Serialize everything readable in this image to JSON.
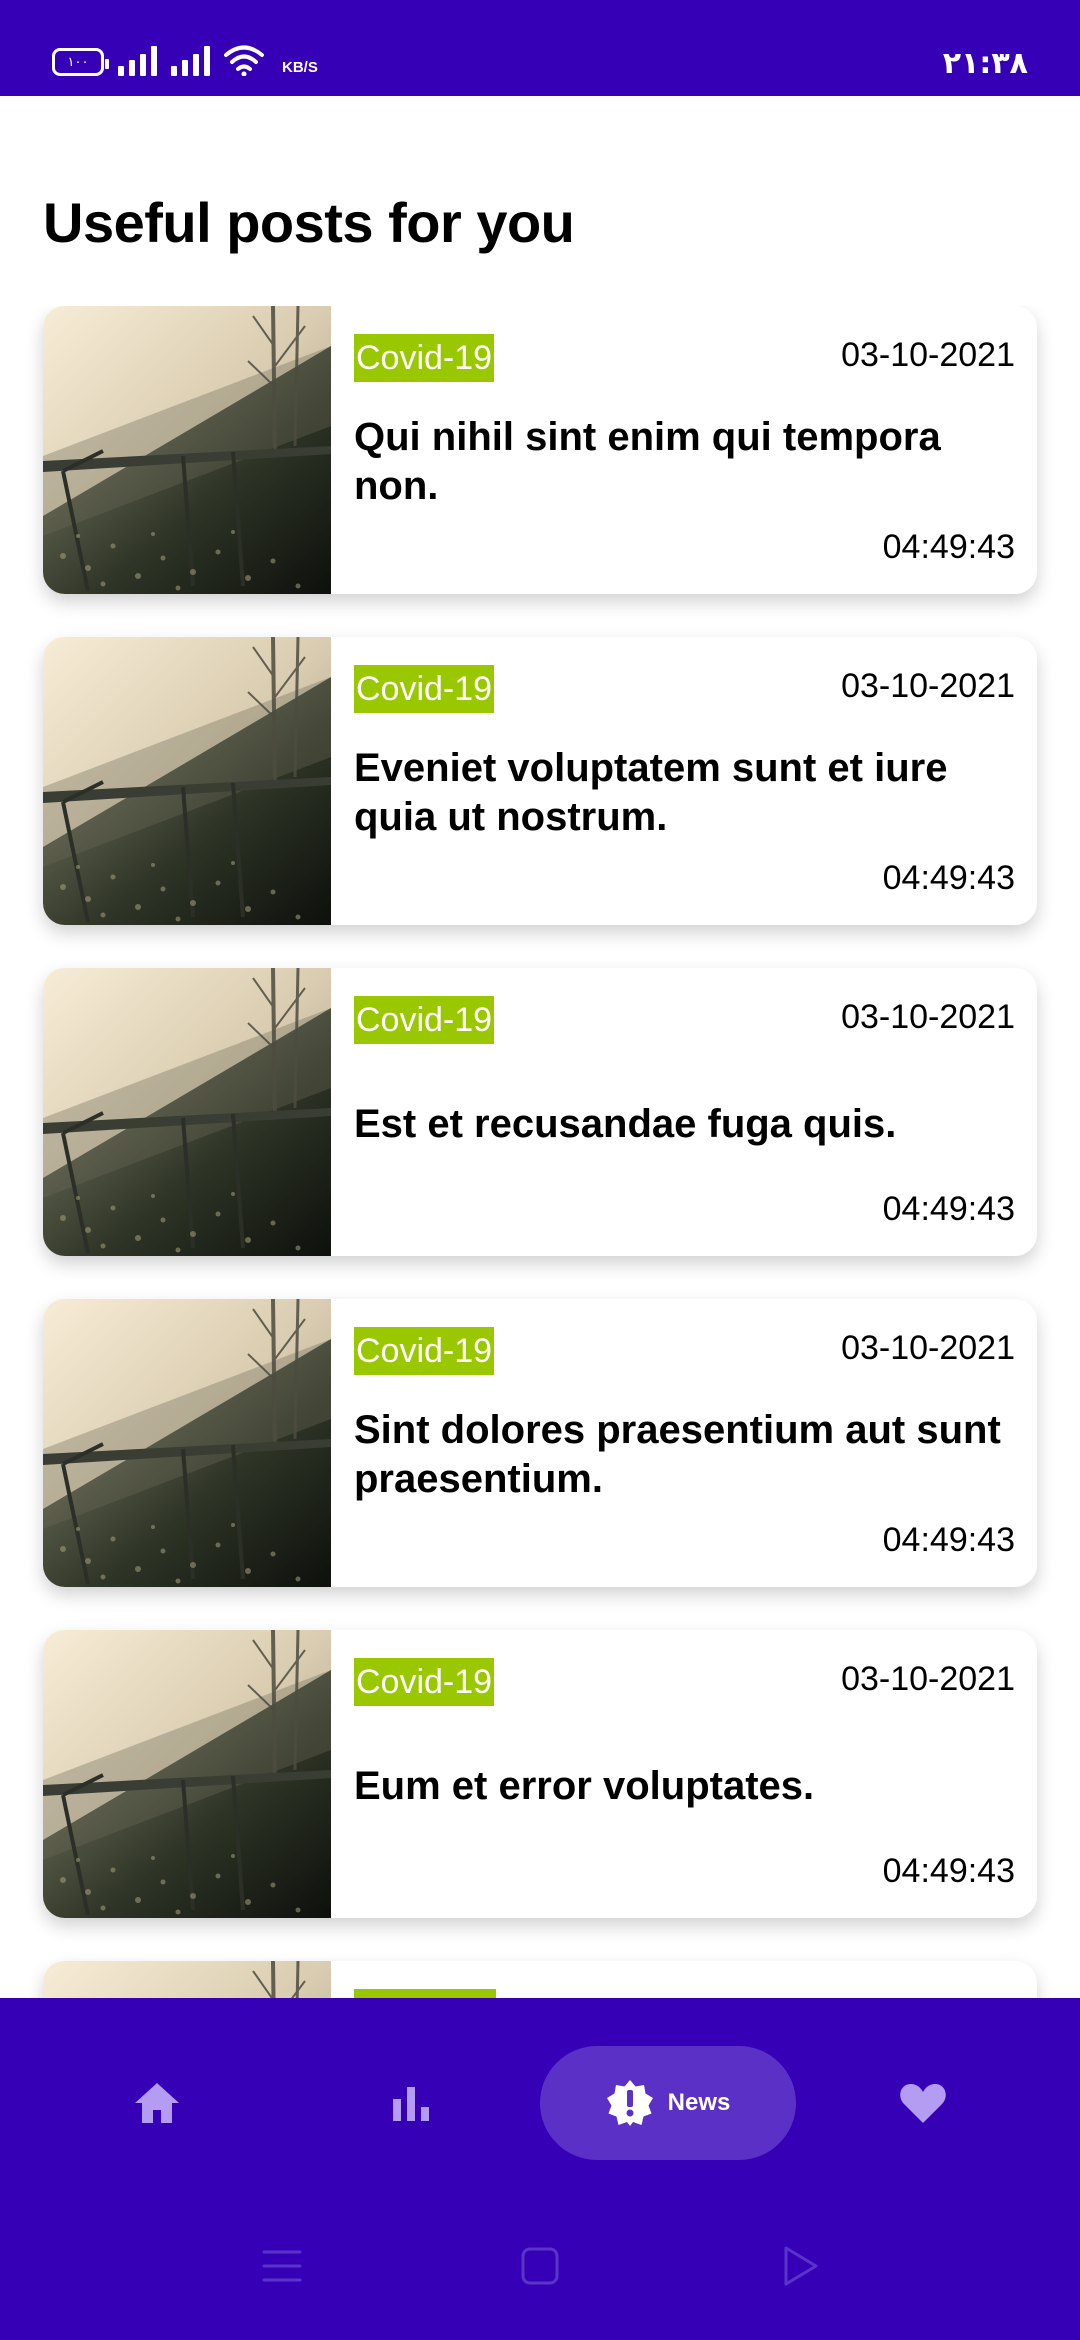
{
  "status_bar": {
    "battery": "۱۰۰",
    "network_speed_unit": "KB/S",
    "clock": "۲۱:۳۸"
  },
  "page": {
    "title": "Useful posts for you"
  },
  "posts": [
    {
      "tag": "Covid-19",
      "date": "03-10-2021",
      "title": "Qui nihil sint enim qui tempora non.",
      "time": "04:49:43"
    },
    {
      "tag": "Covid-19",
      "date": "03-10-2021",
      "title": "Eveniet voluptatem sunt et iure quia ut nostrum.",
      "time": "04:49:43"
    },
    {
      "tag": "Covid-19",
      "date": "03-10-2021",
      "title": "Est et recusandae fuga quis.",
      "time": "04:49:43"
    },
    {
      "tag": "Covid-19",
      "date": "03-10-2021",
      "title": "Sint dolores praesentium aut sunt praesentium.",
      "time": "04:49:43"
    },
    {
      "tag": "Covid-19",
      "date": "03-10-2021",
      "title": "Eum et error voluptates.",
      "time": "04:49:43"
    },
    {
      "tag": "",
      "date": "",
      "title": "",
      "time": ""
    }
  ],
  "bottom_nav": {
    "items": [
      {
        "icon": "home-icon",
        "label": ""
      },
      {
        "icon": "bar-chart-icon",
        "label": ""
      },
      {
        "icon": "news-badge-icon",
        "label": "News",
        "active": true
      },
      {
        "icon": "heart-icon",
        "label": ""
      }
    ]
  },
  "colors": {
    "primary": "#3500b6",
    "active_pill": "#5b30c6",
    "tag_background": "#9ac800",
    "inactive_icon": "#b49cf2"
  }
}
